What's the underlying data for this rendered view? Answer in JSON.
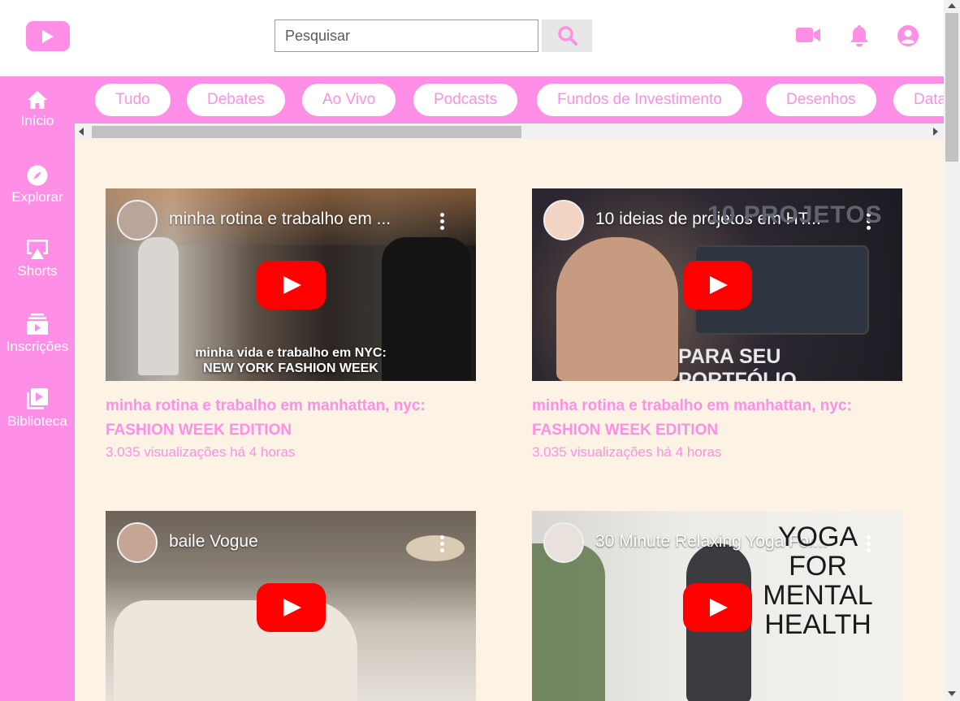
{
  "header": {
    "logo_icon": "youtube-play-icon",
    "search_placeholder": "Pesquisar",
    "search_icon": "search-icon",
    "create_icon": "video-camera-icon",
    "notifications_icon": "bell-icon",
    "account_icon": "user-circle-icon"
  },
  "sidebar": {
    "items": [
      {
        "label": "Início",
        "icon": "home-icon"
      },
      {
        "label": "Explorar",
        "icon": "compass-icon"
      },
      {
        "label": "Shorts",
        "icon": "shorts-icon"
      },
      {
        "label": "Inscrições",
        "icon": "subscriptions-icon"
      },
      {
        "label": "Biblioteca",
        "icon": "library-icon"
      }
    ]
  },
  "chips": [
    "Tudo",
    "Debates",
    "Ao Vivo",
    "Podcasts",
    "Fundos de Investimento",
    "Desenhos",
    "Data"
  ],
  "videos": [
    {
      "embed_title": "minha rotina e trabalho em ...",
      "caption_line1": "minha vida e trabalho em NYC:",
      "caption_line2": "NEW YORK FASHION WEEK",
      "title": "minha rotina e trabalho em manhattan, nyc: FASHION WEEK EDITION",
      "meta": "3.035 visualizações há 4 horas"
    },
    {
      "embed_title": "10 ideias de projetos em HT...",
      "caption_line1": "10 PROJETOS",
      "caption_line2": "PARA SEU PORTFÓLIO",
      "title": "minha rotina e trabalho em manhattan, nyc: FASHION WEEK EDITION",
      "meta": "3.035 visualizações há 4 horas"
    },
    {
      "embed_title": "baile Vogue"
    },
    {
      "embed_title": "30 Minute Relaxing Yoga For...",
      "caption_line1": "YOGA",
      "caption_line2": "FOR",
      "caption_line3": "MENTAL",
      "caption_line4": "HEALTH"
    }
  ],
  "colors": {
    "accent": "#ff8ee6",
    "content_bg": "#fcf3e4",
    "play_red": "#ff0000"
  }
}
